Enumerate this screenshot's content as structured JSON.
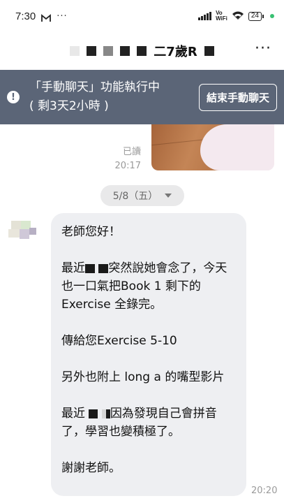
{
  "status_bar": {
    "time": "7:30",
    "dots": "···",
    "vowifi": "Vo\nWiFi",
    "battery": "24"
  },
  "header": {
    "title": "二7歲R",
    "more": "···"
  },
  "banner": {
    "line1": "「手動聊天」功能執行中",
    "line2": "( 剩3天2小時 )",
    "button": "結束手動聊天",
    "icon": "exclamation-icon"
  },
  "previous_message": {
    "read_label": "已讀",
    "time": "20:17"
  },
  "date_chip": {
    "label": "5/8（五）"
  },
  "message": {
    "p1": "老師您好！",
    "p2_a": "最近",
    "p2_b": "突然說她會念",
    "p2_c": "了，今天也一口氣把Book 1 剩下的 Exercise 全錄完。",
    "p3": "傳給您Exercise 5-10",
    "p4": "另外也附上 long a 的嘴型影片",
    "p5_a": "最近",
    "p5_b": "因為發現自己會拼音了，學習也變積極了。",
    "p6": "謝謝老師。",
    "time": "20:20"
  },
  "colors": {
    "banner_bg": "#5b6577",
    "bubble_bg": "#eeeff2",
    "chip_bg": "#e9e9ea"
  }
}
